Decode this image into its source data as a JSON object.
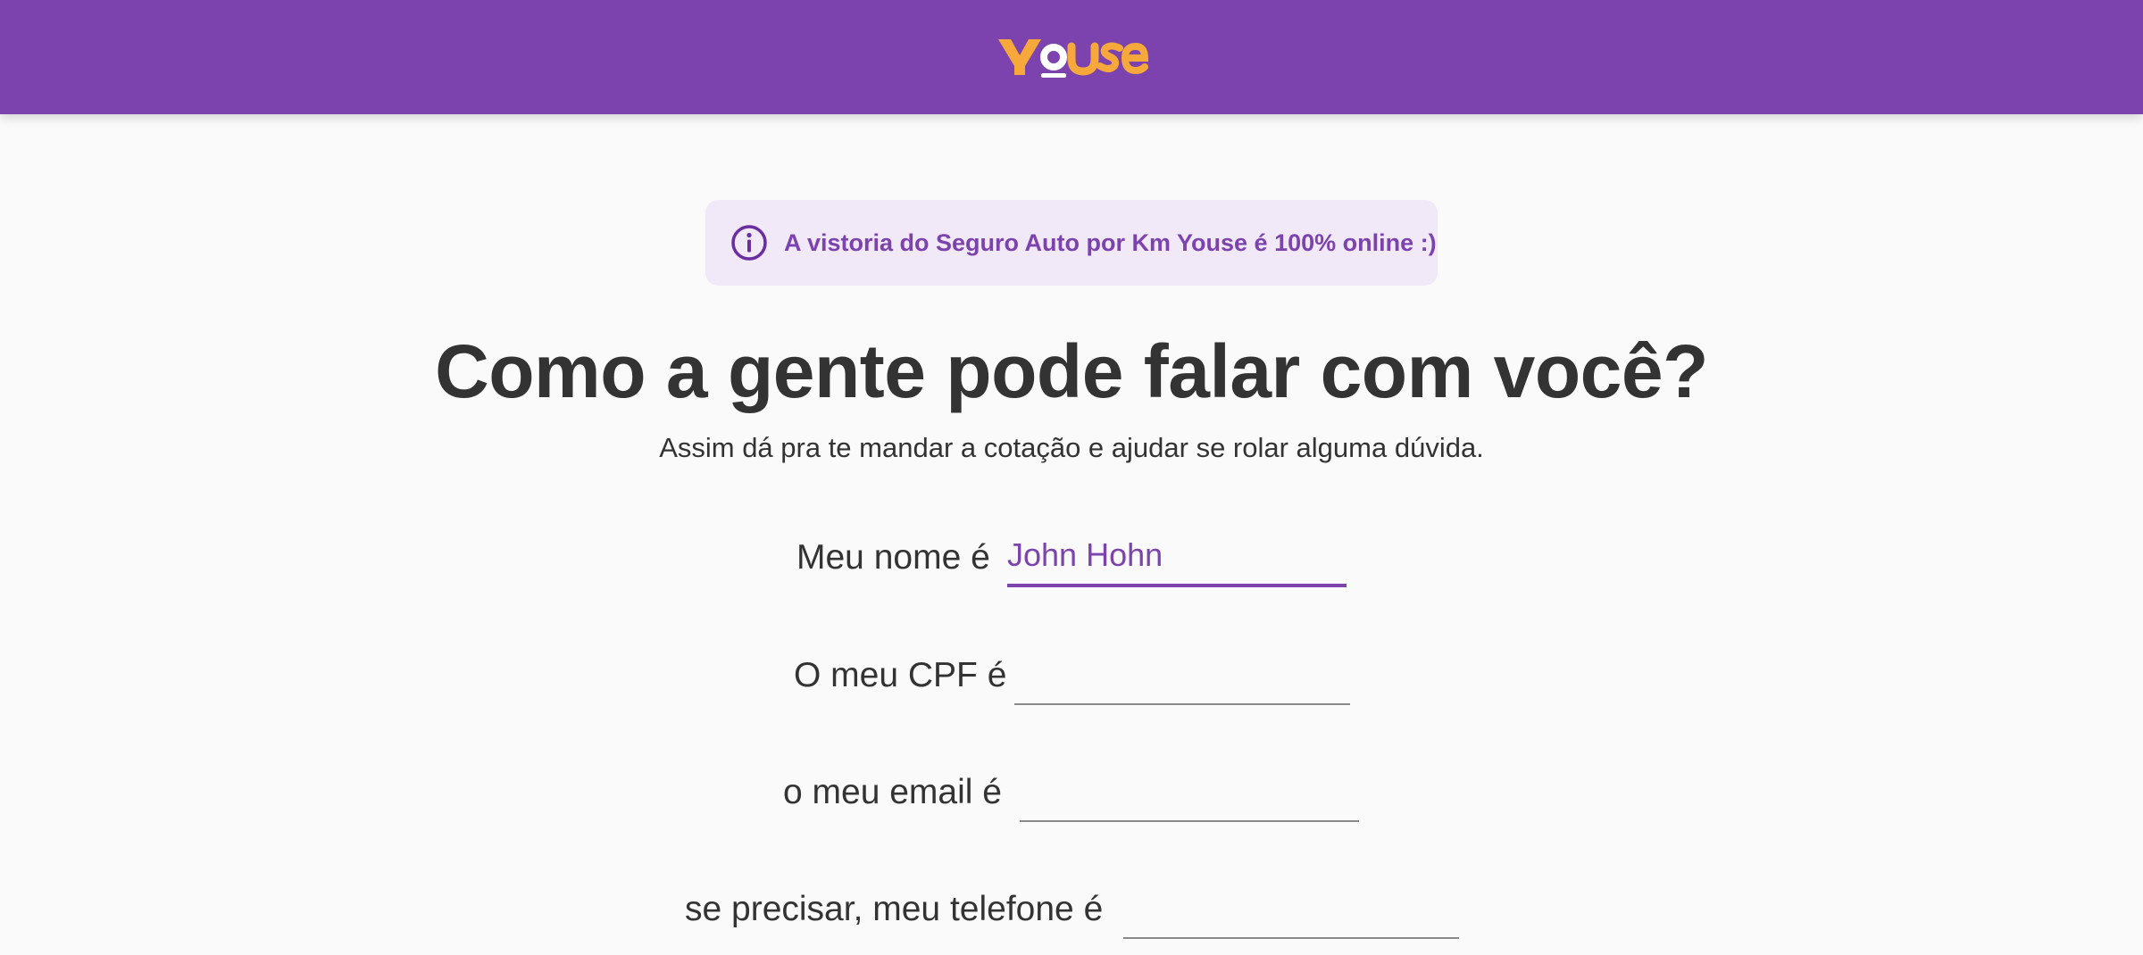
{
  "header": {
    "logo_text": "Youse",
    "colors": {
      "bar": "#7c42ae",
      "logo": "#f7a83a",
      "logo_o": "#ffffff"
    }
  },
  "notice": {
    "icon": "info-icon",
    "text": "A vistoria do Seguro Auto por Km Youse é 100% online :)"
  },
  "main": {
    "title": "Como a gente pode falar com você?",
    "subtitle": "Assim dá pra te mandar a cotação e ajudar se rolar alguma dúvida."
  },
  "form": {
    "name": {
      "label": "Meu nome é",
      "value": "John Hohn"
    },
    "cpf": {
      "label": "O meu CPF é",
      "value": ""
    },
    "email": {
      "label": "o meu email é",
      "value": ""
    },
    "phone": {
      "label": "se precisar, meu telefone é",
      "value": ""
    }
  },
  "colors": {
    "accent": "#7c42ae",
    "text": "#333333",
    "notice_bg": "#f1e9f7"
  }
}
